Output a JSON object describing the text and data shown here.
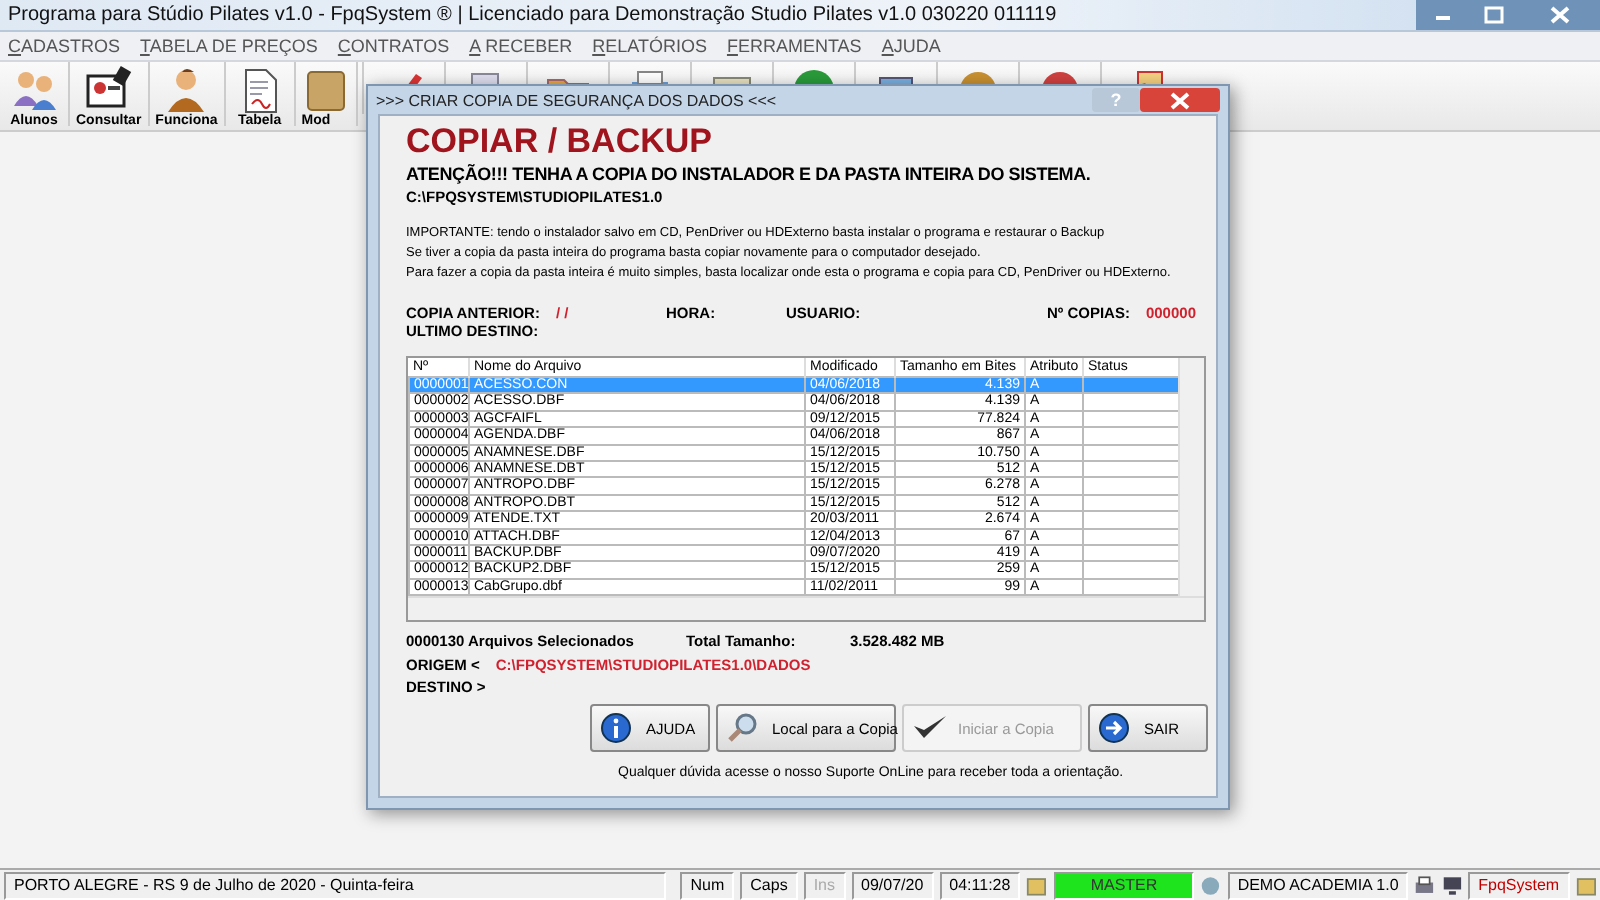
{
  "window": {
    "title": "Programa para Stúdio Pilates v1.0 - FpqSystem ® | Licenciado para  Demonstração Studio Pilates v1.0 030220 011119"
  },
  "menu": [
    "CADASTROS",
    "TABELA DE PREÇOS",
    "CONTRATOS",
    "A RECEBER",
    "RELATÓRIOS",
    "FERRAMENTAS",
    "AJUDA"
  ],
  "toolbar": {
    "buttons": [
      {
        "label": "Alunos"
      },
      {
        "label": "Consultar"
      },
      {
        "label": "Funciona"
      },
      {
        "label": "Tabela"
      },
      {
        "label": "Mod"
      }
    ]
  },
  "dialog": {
    "title": ">>> CRIAR COPIA DE SEGURANÇA DOS DADOS <<<",
    "help_button": "?",
    "heading": "COPIAR / BACKUP",
    "warning": "ATENÇÃO!!!  TENHA A COPIA DO  INSTALADOR  E  DA PASTA INTEIRA DO  SISTEMA.",
    "install_path": "C:\\FPQSYSTEM\\STUDIOPILATES1.0",
    "notes": [
      "IMPORTANTE: tendo o instalador salvo em CD, PenDriver ou HDExterno basta instalar o programa e restaurar o Backup",
      "Se tiver a copia da pasta inteira do programa basta copiar novamente para o computador desejado.",
      "Para fazer a copia da pasta inteira é muito simples, basta localizar onde esta o programa e copia para CD, PenDriver ou HDExterno."
    ],
    "previous_copy": {
      "label": "COPIA ANTERIOR:",
      "value": "/ /"
    },
    "time": {
      "label": "HORA:"
    },
    "user": {
      "label": "USUARIO:"
    },
    "copies": {
      "label": "Nº COPIAS:",
      "value": "000000"
    },
    "last_destination": {
      "label": "ULTIMO DESTINO:"
    },
    "table": {
      "columns": [
        "Nº",
        "Nome do Arquivo",
        "Modificado",
        "Tamanho em Bites",
        "Atributo",
        "Status"
      ],
      "rows": [
        {
          "number": "0000001",
          "name": "ACESSO.CON",
          "modified": "04/06/2018",
          "size": "4.139",
          "attribute": "A",
          "selected": true
        },
        {
          "number": "0000002",
          "name": "ACESSO.DBF",
          "modified": "04/06/2018",
          "size": "4.139",
          "attribute": "A",
          "selected": false
        },
        {
          "number": "0000003",
          "name": "AGCFAIFL",
          "modified": "09/12/2015",
          "size": "77.824",
          "attribute": "A",
          "selected": false
        },
        {
          "number": "0000004",
          "name": "AGENDA.DBF",
          "modified": "04/06/2018",
          "size": "867",
          "attribute": "A",
          "selected": false
        },
        {
          "number": "0000005",
          "name": "ANAMNESE.DBF",
          "modified": "15/12/2015",
          "size": "10.750",
          "attribute": "A",
          "selected": false
        },
        {
          "number": "0000006",
          "name": "ANAMNESE.DBT",
          "modified": "15/12/2015",
          "size": "512",
          "attribute": "A",
          "selected": false
        },
        {
          "number": "0000007",
          "name": "ANTROPO.DBF",
          "modified": "15/12/2015",
          "size": "6.278",
          "attribute": "A",
          "selected": false
        },
        {
          "number": "0000008",
          "name": "ANTROPO.DBT",
          "modified": "15/12/2015",
          "size": "512",
          "attribute": "A",
          "selected": false
        },
        {
          "number": "0000009",
          "name": "ATENDE.TXT",
          "modified": "20/03/2011",
          "size": "2.674",
          "attribute": "A",
          "selected": false
        },
        {
          "number": "0000010",
          "name": "ATTACH.DBF",
          "modified": "12/04/2013",
          "size": "67",
          "attribute": "A",
          "selected": false
        },
        {
          "number": "0000011",
          "name": "BACKUP.DBF",
          "modified": "09/07/2020",
          "size": "419",
          "attribute": "A",
          "selected": false
        },
        {
          "number": "0000012",
          "name": "BACKUP2.DBF",
          "modified": "15/12/2015",
          "size": "259",
          "attribute": "A",
          "selected": false
        },
        {
          "number": "0000013",
          "name": "CabGrupo.dbf",
          "modified": "11/02/2011",
          "size": "99",
          "attribute": "A",
          "selected": false
        }
      ]
    },
    "summary": {
      "count": "0000130 Arquivos  Selecionados",
      "total_label": "Total Tamanho:",
      "total_value": "3.528.482 MB"
    },
    "origin": {
      "label": "ORIGEM  <",
      "value": "C:\\FPQSYSTEM\\STUDIOPILATES1.0\\DADOS"
    },
    "destination": {
      "label": "DESTINO >"
    },
    "buttons": [
      {
        "kind": "help",
        "label": "AJUDA",
        "disabled": false
      },
      {
        "kind": "browse",
        "label": "Local para a Copia",
        "disabled": false
      },
      {
        "kind": "start",
        "label": "Iniciar a Copia",
        "disabled": true
      },
      {
        "kind": "exit",
        "label": "SAIR",
        "disabled": false
      }
    ],
    "footer": "Qualquer dúvida acesse o nosso Suporte OnLine para receber toda a orientação."
  },
  "status_bar": {
    "location": "PORTO ALEGRE - RS  9 de Julho de 2020 - Quinta-feira",
    "keys": [
      {
        "label": "Num",
        "disabled": false
      },
      {
        "label": "Caps",
        "disabled": false
      },
      {
        "label": "Ins",
        "disabled": true
      }
    ],
    "date": "09/07/20",
    "time": "04:11:28",
    "user": "MASTER",
    "product": "DEMO ACADEMIA 1.0",
    "brand": "FpqSystem"
  }
}
